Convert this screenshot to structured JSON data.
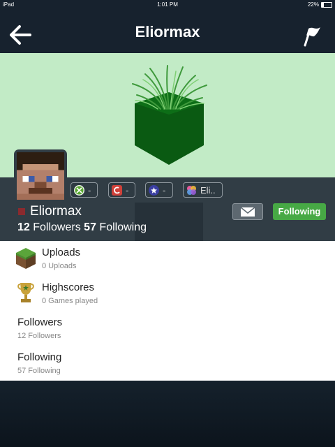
{
  "status_bar": {
    "device": "iPad",
    "time": "1:01 PM",
    "battery": "22%"
  },
  "nav": {
    "title": "Eliormax"
  },
  "profile": {
    "username": "Eliormax",
    "followers_count": "12",
    "followers_label": "Followers",
    "following_count": "57",
    "following_label": "Following",
    "follow_button": "Following",
    "accounts": [
      {
        "service": "xbox",
        "label": "-",
        "color": "#5aa832"
      },
      {
        "service": "playstation-style",
        "label": "-",
        "color": "#d0413a"
      },
      {
        "service": "star-network",
        "label": "-",
        "color": "#3b3fa3"
      },
      {
        "service": "game-center",
        "label": "Eli..",
        "color": "#d86fb0"
      }
    ]
  },
  "menu": [
    {
      "title": "Uploads",
      "subtitle": "0 Uploads",
      "icon": "grass-block-icon"
    },
    {
      "title": "Highscores",
      "subtitle": "0 Games played",
      "icon": "trophy-icon"
    },
    {
      "title": "Followers",
      "subtitle": "12 Followers"
    },
    {
      "title": "Following",
      "subtitle": "57 Following"
    }
  ],
  "colors": {
    "nav_bg": "#17222e",
    "banner_bg": "#c2ebc6",
    "accent_green": "#47a945",
    "block_green": "#0a5a12"
  }
}
